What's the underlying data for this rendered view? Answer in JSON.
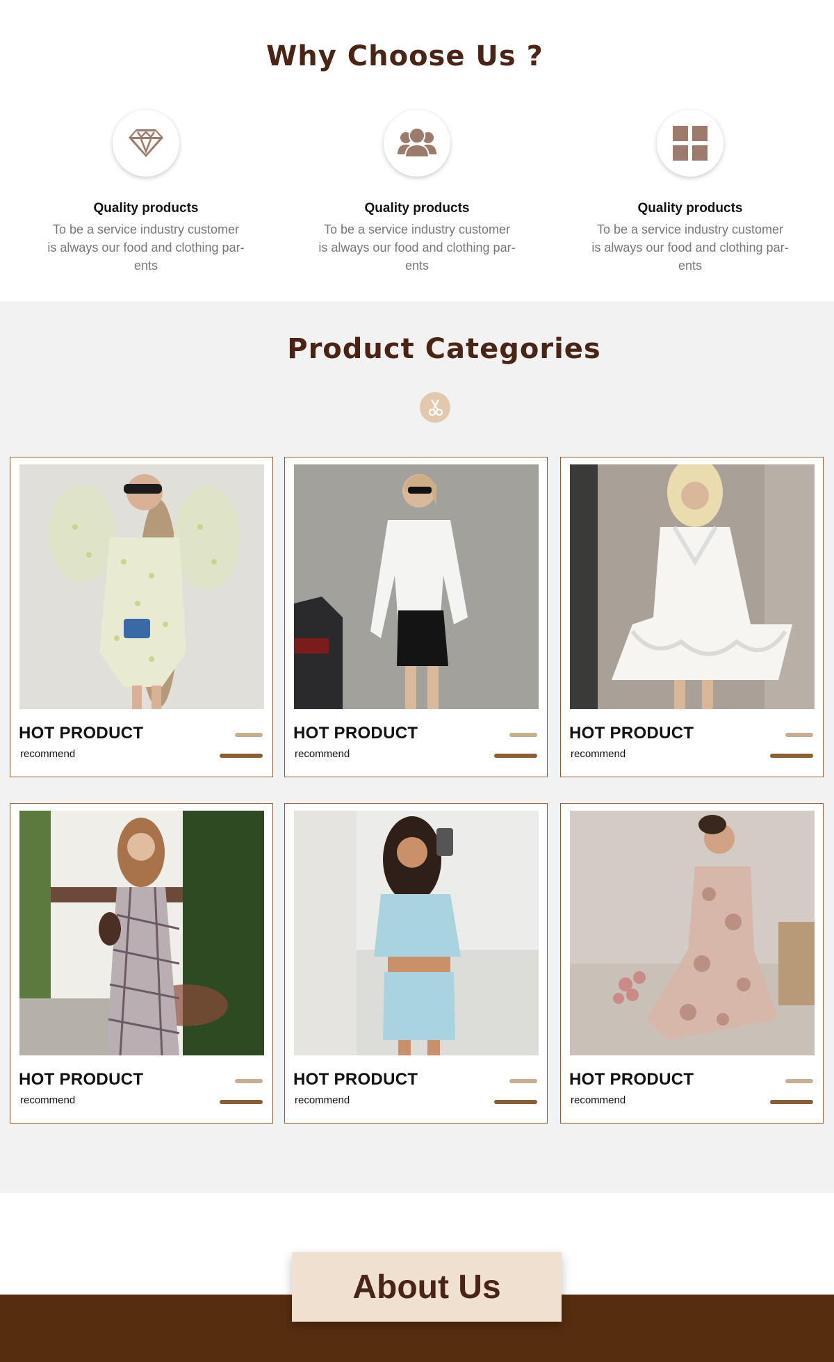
{
  "why": {
    "title": "Why Choose Us ?",
    "features": [
      {
        "icon": "diamond-icon",
        "title": "Quality products",
        "desc_line1": "To be a service industry customer",
        "desc_line2": "is always our food and clothing par-",
        "desc_line3": "ents"
      },
      {
        "icon": "users-icon",
        "title": "Quality products",
        "desc_line1": "To be a service industry customer",
        "desc_line2": "is always our food and clothing par-",
        "desc_line3": "ents"
      },
      {
        "icon": "grid-icon",
        "title": "Quality products",
        "desc_line1": "To be a service industry customer",
        "desc_line2": "is always our food and clothing par-",
        "desc_line3": "ents"
      }
    ]
  },
  "categories": {
    "title": "Product Categories",
    "badge_icon": "scissors-icon",
    "products": [
      {
        "title": "HOT PRODUCT",
        "subtitle": "recommend",
        "photo": "floral puff-sleeve mini dress"
      },
      {
        "title": "HOT PRODUCT",
        "subtitle": "recommend",
        "photo": "white shirt with black leather skirt"
      },
      {
        "title": "HOT PRODUCT",
        "subtitle": "recommend",
        "photo": "white ruffled mini dress"
      },
      {
        "title": "HOT PRODUCT",
        "subtitle": "recommend",
        "photo": "plaid slip midi dress"
      },
      {
        "title": "HOT PRODUCT",
        "subtitle": "recommend",
        "photo": "light blue top and skirt set"
      },
      {
        "title": "HOT PRODUCT",
        "subtitle": "recommend",
        "photo": "pink floral mesh dress"
      }
    ]
  },
  "about": {
    "title": "About Us"
  },
  "colors": {
    "heading": "#4a2414",
    "card_border": "#8f5e35",
    "accent_light": "#c8ae90",
    "accent_dark": "#8d5d32",
    "footer_band": "#562d0f",
    "about_label_bg": "#f0e0d0"
  }
}
